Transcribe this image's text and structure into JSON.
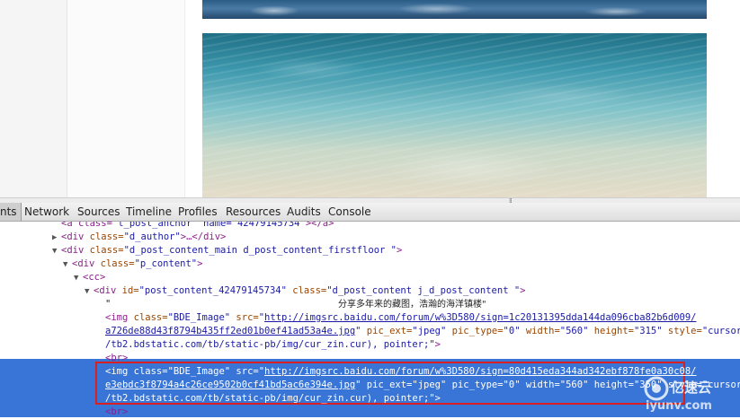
{
  "devtools": {
    "tabs": [
      {
        "label": "nts",
        "active": true
      },
      {
        "label": "Network"
      },
      {
        "label": "Sources"
      },
      {
        "label": "Timeline"
      },
      {
        "label": "Profiles"
      },
      {
        "label": "Resources"
      },
      {
        "label": "Audits"
      },
      {
        "label": "Console"
      }
    ],
    "dom_lines": {
      "l0": {
        "pre": "<a class=\"",
        "mid": "t_post_anchor\" name=\"42479145734\"",
        "post": "></a>"
      },
      "l1": {
        "tag": "<div",
        "attr": " class=",
        "val": "\"d_author\"",
        "rest": ">…</div>"
      },
      "l2": {
        "tag": "<div",
        "attr": " class=",
        "val": "\"d_post_content_main d_post_content_firstfloor \"",
        "rest": ">"
      },
      "l3": {
        "tag": "<div",
        "attr": " class=",
        "val": "\"p_content\"",
        "rest": ">"
      },
      "l4": {
        "tag": "<cc>"
      },
      "l5": {
        "tag": "<div",
        "attr1": " id=",
        "val1": "\"post_content_42479145734\"",
        "attr2": " class=",
        "val2": "\"d_post_content j_d_post_content \"",
        "rest": ">"
      },
      "l6": {
        "q1": "\"",
        "text": "分享多年来的藏图，浩瀚的海洋镇楼\""
      },
      "l7": {
        "tag": "<img",
        "attr1": " class=",
        "val1": "\"BDE_Image\"",
        "attr2": " src=",
        "url1": "http://imgsrc.baidu.com/forum/w%3D580/sign=1c20131395dda144da096cba82b6d009/"
      },
      "l8": {
        "url2": "a726de88d43f8794b435ff2ed01b0ef41ad53a4e.jpg",
        "q": "\"",
        "attr3": " pic_ext=",
        "val3": "\"jpeg\"",
        "attr4": " pic_type=",
        "val4": "\"0\"",
        "attr5": " width=",
        "val5": "\"560\"",
        "attr6": " height=",
        "val6": "\"315\"",
        "attr7": " style=",
        "val7": "\"cursor: url("
      },
      "l9": {
        "text": "/tb2.bdstatic.com/tb/static-pb/img/cur_zin.cur), pointer;\"",
        "rest": ">"
      },
      "l10": {
        "tag": "<br>"
      },
      "l11": {
        "tag": "<img",
        "attr1": " class=",
        "val1": "\"BDE_Image\"",
        "attr2": " src=",
        "url1": "http://imgsrc.baidu.com/forum/w%3D580/sign=80d415eda344ad342ebf878fe0a30c08/"
      },
      "l12": {
        "url2": "e3ebdc3f8794a4c26ce9502b0cf41bd5ac6e394e.jpg",
        "q": "\"",
        "attr3": " pic_ext=",
        "val3": "\"jpeg\"",
        "attr4": " pic_type=",
        "val4": "\"0\"",
        "attr5": " width=",
        "val5": "\"560\"",
        "attr6": " height=",
        "val6": "\"350\"",
        "attr7": " sty",
        "val7": "le=\"cursor: url("
      },
      "l13": {
        "text": "/tb2.bdstatic.com/tb/static-pb/img/cur_zin.cur), pointer;\"",
        "rest": ">"
      },
      "l14": {
        "tag": "<br>"
      }
    }
  },
  "watermark": {
    "line1": "亿速云",
    "line2": "iyunv.com"
  },
  "colors": {
    "selection": "#3875d7",
    "highlight_box": "#d82020"
  }
}
